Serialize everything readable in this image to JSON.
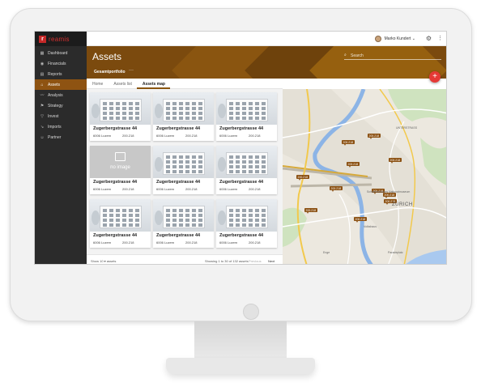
{
  "app": {
    "logo_mark": "r",
    "logo_text": "reamis"
  },
  "sidebar": {
    "items": [
      {
        "label": "Dashboard",
        "icon": "grid-icon",
        "glyph": "▦",
        "active": false
      },
      {
        "label": "Financials",
        "icon": "coin-icon",
        "glyph": "◉",
        "active": false
      },
      {
        "label": "Reports",
        "icon": "document-icon",
        "glyph": "▤",
        "active": false
      },
      {
        "label": "Assets",
        "icon": "home-icon",
        "glyph": "⌂",
        "active": true
      },
      {
        "label": "Analysis",
        "icon": "trend-icon",
        "glyph": "〰",
        "active": false
      },
      {
        "label": "Strategy",
        "icon": "flag-icon",
        "glyph": "⚑",
        "active": false
      },
      {
        "label": "Invest",
        "icon": "funnel-icon",
        "glyph": "▽",
        "active": false
      },
      {
        "label": "Imports",
        "icon": "import-icon",
        "glyph": "↘",
        "active": false
      },
      {
        "label": "Partner",
        "icon": "people-icon",
        "glyph": "☺",
        "active": false
      }
    ]
  },
  "topbar": {
    "user_name": "Marko Kundert ⌄",
    "gear": "⚙",
    "kebab": "⋮"
  },
  "header": {
    "title": "Assets",
    "search_placeholder": "Search",
    "portfolio": "Gesamtportfolio",
    "portfolio_menu": "···"
  },
  "tabs": [
    {
      "label": "Home",
      "active": false
    },
    {
      "label": "Assets list",
      "active": false
    },
    {
      "label": "Assets map",
      "active": true
    }
  ],
  "fab": "+",
  "cards": [
    {
      "title": "Zugerbergstrasse 44",
      "city": "6006 Luzern",
      "value": "200.218",
      "no_image": false
    },
    {
      "title": "Zugerbergstrasse 44",
      "city": "6006 Luzern",
      "value": "200.218",
      "no_image": false
    },
    {
      "title": "Zugerbergstrasse 44",
      "city": "6006 Luzern",
      "value": "200.218",
      "no_image": false
    },
    {
      "title": "Zugerbergstrasse 44",
      "city": "6006 Luzern",
      "value": "200.218",
      "no_image": true
    },
    {
      "title": "Zugerbergstrasse 44",
      "city": "6006 Luzern",
      "value": "200.218",
      "no_image": false
    },
    {
      "title": "Zugerbergstrasse 44",
      "city": "6006 Luzern",
      "value": "200.218",
      "no_image": false
    },
    {
      "title": "Zugerbergstrasse 44",
      "city": "6006 Luzern",
      "value": "200.218",
      "no_image": false
    },
    {
      "title": "Zugerbergstrasse 44",
      "city": "6006 Luzern",
      "value": "200.218",
      "no_image": false
    },
    {
      "title": "Zugerbergstrasse 44",
      "city": "6006 Luzern",
      "value": "200.218",
      "no_image": false
    }
  ],
  "no_image_label": "no image",
  "footer": {
    "show": "Show  10 ▾ assets",
    "count": "Showing 1 to 30 of 132 assets",
    "prev": "Previous",
    "next": "Next"
  },
  "map": {
    "pins": [
      {
        "label": "200.218"
      },
      {
        "label": "200.218"
      },
      {
        "label": "200.218"
      },
      {
        "label": "200.218"
      },
      {
        "label": "200.218"
      },
      {
        "label": "200.218"
      },
      {
        "label": "200.218"
      },
      {
        "label": "200.218"
      },
      {
        "label": "200.218"
      },
      {
        "label": "200.218"
      },
      {
        "label": "200.218"
      }
    ],
    "labels": [
      "UNTERSTRASS",
      "Schweizerisches Nationalmuseum",
      "ZÜRICH",
      "Volkshaus",
      "Paradeplatz",
      "Enge"
    ]
  },
  "colors": {
    "accent": "#8a5510",
    "fab": "#e53935",
    "sidebar": "#2b2b2b"
  }
}
